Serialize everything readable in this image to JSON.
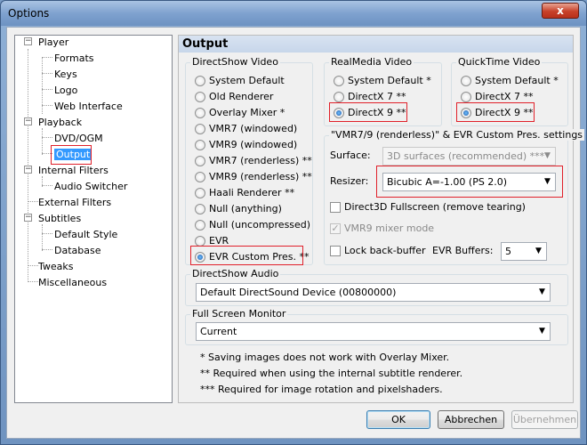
{
  "window": {
    "title": "Options",
    "close_glyph": "x"
  },
  "tree": {
    "items": [
      {
        "label": "Player"
      },
      {
        "label": "Formats"
      },
      {
        "label": "Keys"
      },
      {
        "label": "Logo"
      },
      {
        "label": "Web Interface"
      },
      {
        "label": "Playback"
      },
      {
        "label": "DVD/OGM"
      },
      {
        "label": "Output"
      },
      {
        "label": "Internal Filters"
      },
      {
        "label": "Audio Switcher"
      },
      {
        "label": "External Filters"
      },
      {
        "label": "Subtitles"
      },
      {
        "label": "Default Style"
      },
      {
        "label": "Database"
      },
      {
        "label": "Tweaks"
      },
      {
        "label": "Miscellaneous"
      }
    ]
  },
  "page": {
    "title": "Output",
    "directshow_video": {
      "label": "DirectShow Video",
      "options": [
        "System Default",
        "Old Renderer",
        "Overlay Mixer *",
        "VMR7 (windowed)",
        "VMR9 (windowed)",
        "VMR7 (renderless) **",
        "VMR9 (renderless) **",
        "Haali Renderer **",
        "Null (anything)",
        "Null (uncompressed)",
        "EVR",
        "EVR Custom Pres. **"
      ],
      "selected_index": 11
    },
    "realmedia_video": {
      "label": "RealMedia Video",
      "options": [
        "System Default *",
        "DirectX 7 **",
        "DirectX 9 **"
      ],
      "selected_index": 2
    },
    "quicktime_video": {
      "label": "QuickTime Video",
      "options": [
        "System Default *",
        "DirectX 7 **",
        "DirectX 9 **"
      ],
      "selected_index": 2
    },
    "vmr_settings": {
      "label": "\"VMR7/9 (renderless)\" & EVR Custom Pres. settings",
      "surface_label": "Surface:",
      "surface_value": "3D surfaces (recommended) ***",
      "resizer_label": "Resizer:",
      "resizer_value": "Bicubic A=-1.00 (PS 2.0)",
      "d3d_fullscreen": "Direct3D Fullscreen (remove tearing)",
      "vmr9_mixer": "VMR9 mixer mode",
      "vmr9_mixer_check": "✓",
      "lock_backbuffer": "Lock back-buffer",
      "evr_buffers_label": "EVR Buffers:",
      "evr_buffers_value": "5"
    },
    "directshow_audio": {
      "label": "DirectShow Audio",
      "device": "Default DirectSound Device (00800000)"
    },
    "fullscreen_monitor": {
      "label": "Full Screen Monitor",
      "value": "Current"
    },
    "notes": [
      "* Saving images does not work with Overlay Mixer.",
      "** Required when using the internal subtitle renderer.",
      "*** Required for image rotation and pixelshaders."
    ]
  },
  "buttons": {
    "ok": "OK",
    "cancel": "Abbrechen",
    "apply": "Übernehmen"
  },
  "colors": {
    "highlight": "#e0202a",
    "selection": "#3399ff"
  }
}
